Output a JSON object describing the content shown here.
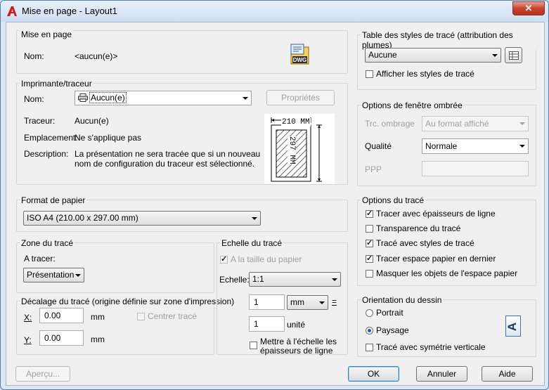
{
  "window": {
    "title": "Mise en page - Layout1",
    "close_glyph": "✕"
  },
  "mise_en_page": {
    "group": "Mise en page",
    "name_label": "Nom:",
    "name_value": "<aucun(e)>",
    "icon_text": "DWG"
  },
  "imprimante": {
    "group": "Imprimante/traceur",
    "name_label": "Nom:",
    "name_value": "Aucun(e)",
    "properties_button": "Propriétés",
    "traceur_label": "Traceur:",
    "traceur_value": "Aucun(e)",
    "emplacement_label": "Emplacement:",
    "emplacement_value": "Ne s'applique pas",
    "description_label": "Description:",
    "description_line1": "La présentation ne sera tracée que si un nouveau",
    "description_line2": "nom de configuration du traceur est sélectionné.",
    "paper_width": "210  MM",
    "paper_height": "297  MM"
  },
  "format_papier": {
    "group": "Format de papier",
    "value": "ISO A4 (210.00 x 297.00 mm)"
  },
  "zone_trace": {
    "group": "Zone du tracé",
    "a_tracer_label": "A tracer:",
    "value": "Présentation"
  },
  "decalage": {
    "group": "Décalage du tracé (origine définie sur zone d'impression)",
    "x_label": "X:",
    "x_value": "0.00",
    "x_unit": "mm",
    "y_label": "Y:",
    "y_value": "0.00",
    "y_unit": "mm",
    "centrer_label": "Centrer tracé"
  },
  "echelle": {
    "group": "Echelle du tracé",
    "fit_label": "A la taille du papier",
    "echelle_label": "Echelle:",
    "echelle_value": "1:1",
    "value1": "1",
    "unit1": "mm",
    "equals": "=",
    "value2": "1",
    "unit2": "unité",
    "lineweights_line1": "Mettre à l'échelle les",
    "lineweights_line2": "épaisseurs de ligne"
  },
  "table_styles": {
    "group": "Table des styles de tracé (attribution des plumes)",
    "value": "Aucune",
    "show_label": "Afficher les styles de tracé"
  },
  "fenetre_ombree": {
    "group": "Options de fenêtre ombrée",
    "trc_label": "Trc. ombrage",
    "trc_value": "Au format affiché",
    "qualite_label": "Qualité",
    "qualite_value": "Normale",
    "ppp_label": "PPP",
    "ppp_value": ""
  },
  "options_trace": {
    "group": "Options du tracé",
    "items": [
      {
        "label": "Tracer avec épaisseurs de ligne",
        "checked": true
      },
      {
        "label": "Transparence du tracé",
        "checked": false
      },
      {
        "label": "Tracé avec styles de tracé",
        "checked": true
      },
      {
        "label": "Tracer espace papier en dernier",
        "checked": true
      },
      {
        "label": "Masquer les objets de l'espace papier",
        "checked": false
      }
    ]
  },
  "orientation": {
    "group": "Orientation du dessin",
    "portrait": "Portrait",
    "paysage": "Paysage",
    "inverse": "Tracé avec symétrie verticale",
    "icon_letter": "A"
  },
  "buttons": {
    "apercu": "Aperçu...",
    "ok": "OK",
    "annuler": "Annuler",
    "aide": "Aide"
  }
}
